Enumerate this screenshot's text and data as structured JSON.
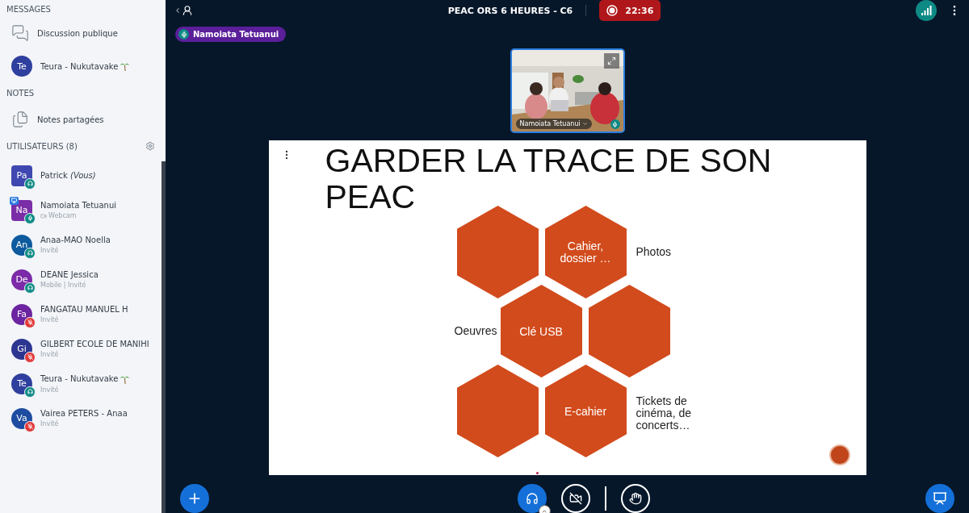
{
  "sidebar": {
    "messages": {
      "title": "MESSAGES",
      "items": [
        {
          "kind": "public",
          "label": "Discussion publique"
        },
        {
          "kind": "private",
          "initials": "Te",
          "color": "#2e3f9e",
          "label": "Teura - Nukutavake",
          "palm": true
        }
      ]
    },
    "notes": {
      "title": "NOTES",
      "items": [
        {
          "label": "Notes partagées"
        }
      ]
    },
    "users": {
      "title": "UTILISATEURS (8)",
      "items": [
        {
          "initials": "Pa",
          "name": "Patrick *(Vous)*",
          "moderator": true,
          "color": "#3f48b0",
          "kind": "listen",
          "presenter": false
        },
        {
          "initials": "Na",
          "name": "Namoiata Tetuanui",
          "subtitle": "Webcam",
          "webcam": true,
          "moderator": true,
          "color": "#7b2da8",
          "kind": "mic",
          "presenter": true
        },
        {
          "initials": "An",
          "name": "Anaa-MAO Noella",
          "subtitle": "Invité",
          "moderator": false,
          "color": "#0d5a9e",
          "kind": "listen",
          "presenter": false
        },
        {
          "initials": "De",
          "name": "DEANE Jessica",
          "subtitle": "Mobile | Invité",
          "moderator": false,
          "color": "#7b2aa8",
          "kind": "listen",
          "presenter": false
        },
        {
          "initials": "Fa",
          "name": "FANGATAU MANUEL H",
          "subtitle": "Invité",
          "moderator": false,
          "color": "#6c24a0",
          "kind": "muted",
          "presenter": false
        },
        {
          "initials": "Gi",
          "name": "GILBERT ECOLE DE MANIHI",
          "subtitle": "Invité",
          "moderator": false,
          "color": "#2c3590",
          "kind": "muted",
          "presenter": false
        },
        {
          "initials": "Te",
          "name": "Teura - Nukutavake",
          "palm": true,
          "subtitle": "Invité",
          "moderator": false,
          "color": "#2e3f9e",
          "kind": "listen",
          "presenter": false
        },
        {
          "initials": "Va",
          "name": "Vairea PETERS - Anaa",
          "subtitle": "Invité",
          "moderator": false,
          "color": "#1d4ca0",
          "kind": "muted",
          "presenter": false
        }
      ]
    }
  },
  "topbar": {
    "title": "PEAC ORS 6 HEURES - C6",
    "recording": {
      "on": true,
      "time": "22:36"
    }
  },
  "talker": {
    "name": "Namoiata Tetuanui"
  },
  "webcam": {
    "name": "Namoiata Tetuanui"
  },
  "slide": {
    "title": "GARDER LA TRACE DE SON PEAC",
    "hex_rows": [
      {
        "hexagons": [
          {
            "kind": "blank"
          },
          {
            "kind": "text",
            "label": "Cahier, dossier …"
          }
        ],
        "right_label": "Photos"
      },
      {
        "left_label": "Oeuvres",
        "hexagons": [
          {
            "kind": "text",
            "label": "Clé USB"
          },
          {
            "kind": "blank"
          }
        ]
      },
      {
        "hexagons": [
          {
            "kind": "blank"
          },
          {
            "kind": "text",
            "label": "E-cahier"
          }
        ],
        "right_label": "Tickets de cinéma, de concerts…"
      }
    ]
  },
  "toolbar": {
    "kind": "listen",
    "webcam_on": false
  }
}
